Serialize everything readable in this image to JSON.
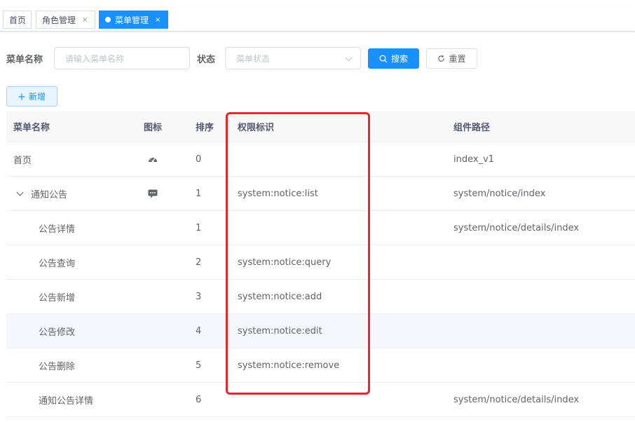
{
  "tags": {
    "home": "首页",
    "role": "角色管理",
    "menu": "菜单管理",
    "close": "×"
  },
  "search": {
    "name_label": "菜单名称",
    "name_placeholder": "请输入菜单名称",
    "status_label": "状态",
    "status_placeholder": "菜单状态",
    "search_button": "搜索",
    "reset_button": "重置",
    "add_button": "新增"
  },
  "table": {
    "columns": {
      "name": "菜单名称",
      "icon": "图标",
      "order": "排序",
      "perm": "权限标识",
      "path": "组件路径"
    },
    "rows": [
      {
        "name": "首页",
        "icon": "dashboard-icon",
        "order": "0",
        "perm": "",
        "path": "index_v1"
      },
      {
        "name": "通知公告",
        "icon": "message-icon",
        "order": "1",
        "perm": "system:notice:list",
        "path": "system/notice/index"
      },
      {
        "name": "公告详情",
        "icon": "",
        "order": "1",
        "perm": "",
        "path": "system/notice/details/index"
      },
      {
        "name": "公告查询",
        "icon": "",
        "order": "2",
        "perm": "system:notice:query",
        "path": ""
      },
      {
        "name": "公告新增",
        "icon": "",
        "order": "3",
        "perm": "system:notice:add",
        "path": ""
      },
      {
        "name": "公告修改",
        "icon": "",
        "order": "4",
        "perm": "system:notice:edit",
        "path": ""
      },
      {
        "name": "公告删除",
        "icon": "",
        "order": "5",
        "perm": "system:notice:remove",
        "path": ""
      },
      {
        "name": "通知公告详情",
        "icon": "",
        "order": "6",
        "perm": "",
        "path": "system/notice/details/index"
      }
    ]
  },
  "colors": {
    "primary": "#1890ff",
    "highlight": "#e8262b"
  }
}
